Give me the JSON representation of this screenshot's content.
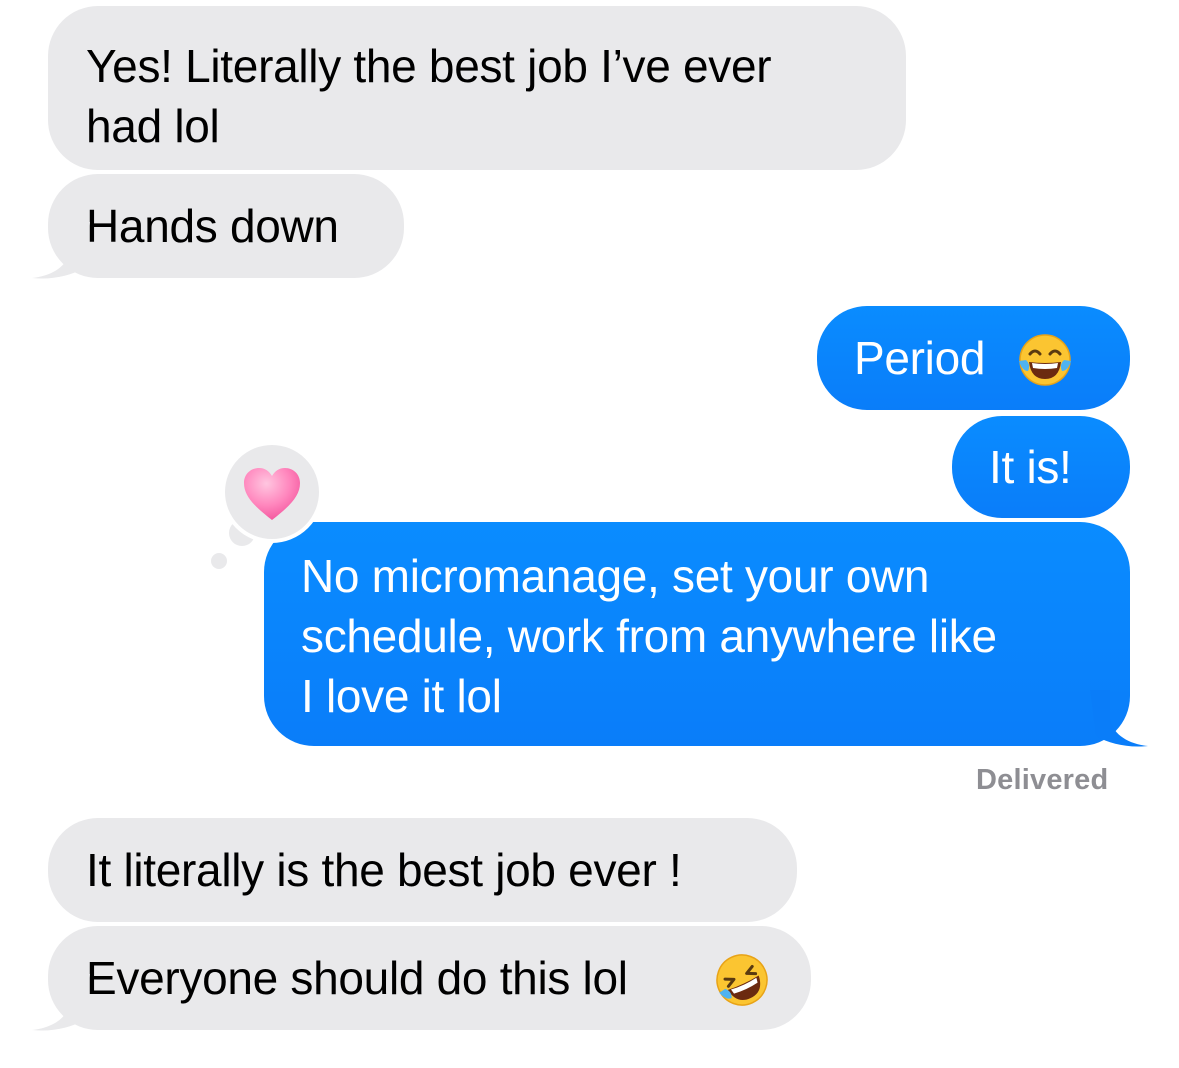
{
  "conversation": {
    "messages": [
      {
        "sender": "them",
        "lines": [
          "Yes! Literally the best job I’ve ever",
          "had lol"
        ]
      },
      {
        "sender": "them",
        "text": "Hands down"
      },
      {
        "sender": "me",
        "text": "Period",
        "emoji": "face-with-tears-of-joy"
      },
      {
        "sender": "me",
        "text": "It is!"
      },
      {
        "sender": "me",
        "lines": [
          "No micromanage, set your own",
          "schedule, work from anywhere like",
          "I love it lol"
        ],
        "reaction": "pink-heart"
      },
      {
        "sender": "them",
        "text": "It literally is the best job ever !"
      },
      {
        "sender": "them",
        "text": "Everyone should do this lol",
        "emoji": "rolling-on-the-floor-laughing"
      }
    ],
    "status": "Delivered"
  },
  "colors": {
    "received_bubble": "#e9e9eb",
    "sent_bubble": "#0a84ff",
    "status_text": "#8e8e93"
  }
}
